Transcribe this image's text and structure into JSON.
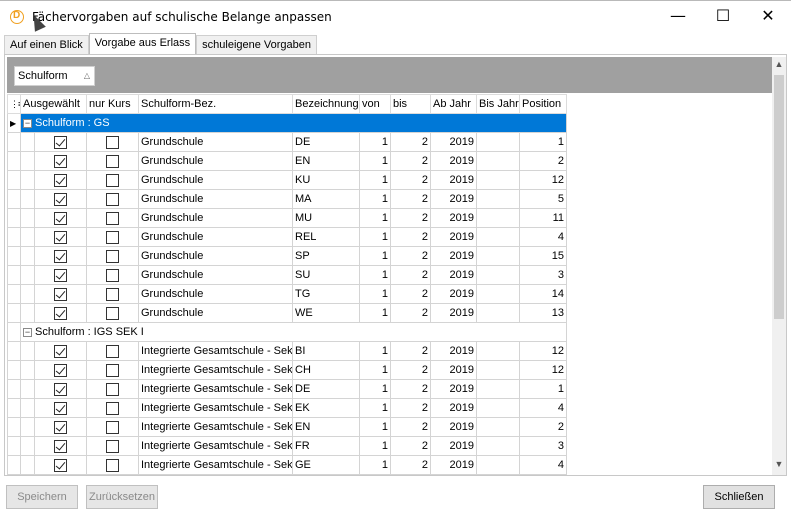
{
  "window": {
    "title": "Fächervorgaben auf schulische Belange anpassen",
    "minimize": "—",
    "maximize": "☐",
    "close": "✕"
  },
  "tabs": [
    {
      "label": "Auf einen Blick",
      "active": false
    },
    {
      "label": "Vorgabe aus Erlass",
      "active": true
    },
    {
      "label": "schuleigene Vorgaben",
      "active": false
    }
  ],
  "grouping": {
    "chip_label": "Schulform",
    "chip_sort_icon": "sort-asc-icon"
  },
  "grid": {
    "columns": [
      "Ausgewählt",
      "nur Kurs",
      "Schulform-Bez.",
      "Bezeichnung",
      "von",
      "bis",
      "Ab Jahr",
      "Bis Jahr",
      "Position"
    ],
    "groups": [
      {
        "label": "Schulform : GS",
        "selected": true,
        "rows": [
          {
            "ausgewaehlt": true,
            "nur_kurs": false,
            "schulform": "Grundschule",
            "bez": "DE",
            "von": "1",
            "bis": "2",
            "ab": "2019",
            "bis_jahr": "",
            "pos": "1"
          },
          {
            "ausgewaehlt": true,
            "nur_kurs": false,
            "schulform": "Grundschule",
            "bez": "EN",
            "von": "1",
            "bis": "2",
            "ab": "2019",
            "bis_jahr": "",
            "pos": "2"
          },
          {
            "ausgewaehlt": true,
            "nur_kurs": false,
            "schulform": "Grundschule",
            "bez": "KU",
            "von": "1",
            "bis": "2",
            "ab": "2019",
            "bis_jahr": "",
            "pos": "12"
          },
          {
            "ausgewaehlt": true,
            "nur_kurs": false,
            "schulform": "Grundschule",
            "bez": "MA",
            "von": "1",
            "bis": "2",
            "ab": "2019",
            "bis_jahr": "",
            "pos": "5"
          },
          {
            "ausgewaehlt": true,
            "nur_kurs": false,
            "schulform": "Grundschule",
            "bez": "MU",
            "von": "1",
            "bis": "2",
            "ab": "2019",
            "bis_jahr": "",
            "pos": "11"
          },
          {
            "ausgewaehlt": true,
            "nur_kurs": false,
            "schulform": "Grundschule",
            "bez": "REL",
            "von": "1",
            "bis": "2",
            "ab": "2019",
            "bis_jahr": "",
            "pos": "4"
          },
          {
            "ausgewaehlt": true,
            "nur_kurs": false,
            "schulform": "Grundschule",
            "bez": "SP",
            "von": "1",
            "bis": "2",
            "ab": "2019",
            "bis_jahr": "",
            "pos": "15"
          },
          {
            "ausgewaehlt": true,
            "nur_kurs": false,
            "schulform": "Grundschule",
            "bez": "SU",
            "von": "1",
            "bis": "2",
            "ab": "2019",
            "bis_jahr": "",
            "pos": "3"
          },
          {
            "ausgewaehlt": true,
            "nur_kurs": false,
            "schulform": "Grundschule",
            "bez": "TG",
            "von": "1",
            "bis": "2",
            "ab": "2019",
            "bis_jahr": "",
            "pos": "14"
          },
          {
            "ausgewaehlt": true,
            "nur_kurs": false,
            "schulform": "Grundschule",
            "bez": "WE",
            "von": "1",
            "bis": "2",
            "ab": "2019",
            "bis_jahr": "",
            "pos": "13"
          }
        ]
      },
      {
        "label": "Schulform : IGS SEK I",
        "selected": false,
        "rows": [
          {
            "ausgewaehlt": true,
            "nur_kurs": false,
            "schulform": "Integrierte Gesamtschule - Sek",
            "bez": "BI",
            "von": "1",
            "bis": "2",
            "ab": "2019",
            "bis_jahr": "",
            "pos": "12"
          },
          {
            "ausgewaehlt": true,
            "nur_kurs": false,
            "schulform": "Integrierte Gesamtschule - Sek",
            "bez": "CH",
            "von": "1",
            "bis": "2",
            "ab": "2019",
            "bis_jahr": "",
            "pos": "12"
          },
          {
            "ausgewaehlt": true,
            "nur_kurs": false,
            "schulform": "Integrierte Gesamtschule - Sek",
            "bez": "DE",
            "von": "1",
            "bis": "2",
            "ab": "2019",
            "bis_jahr": "",
            "pos": "1"
          },
          {
            "ausgewaehlt": true,
            "nur_kurs": false,
            "schulform": "Integrierte Gesamtschule - Sek",
            "bez": "EK",
            "von": "1",
            "bis": "2",
            "ab": "2019",
            "bis_jahr": "",
            "pos": "4"
          },
          {
            "ausgewaehlt": true,
            "nur_kurs": false,
            "schulform": "Integrierte Gesamtschule - Sek",
            "bez": "EN",
            "von": "1",
            "bis": "2",
            "ab": "2019",
            "bis_jahr": "",
            "pos": "2"
          },
          {
            "ausgewaehlt": true,
            "nur_kurs": false,
            "schulform": "Integrierte Gesamtschule - Sek",
            "bez": "FR",
            "von": "1",
            "bis": "2",
            "ab": "2019",
            "bis_jahr": "",
            "pos": "3"
          },
          {
            "ausgewaehlt": true,
            "nur_kurs": false,
            "schulform": "Integrierte Gesamtschule - Sek",
            "bez": "GE",
            "von": "1",
            "bis": "2",
            "ab": "2019",
            "bis_jahr": "",
            "pos": "4"
          },
          {
            "ausgewaehlt": true,
            "nur_kurs": false,
            "schulform": "",
            "bez": "",
            "von": "",
            "bis": "",
            "ab": "",
            "bis_jahr": "",
            "pos": ""
          }
        ]
      }
    ]
  },
  "footer": {
    "save": "Speichern",
    "reset": "Zurücksetzen",
    "close": "Schließen"
  },
  "colors": {
    "selection": "#0078d7",
    "group_bar": "#a0a0a0",
    "app_icon": "#f0a020"
  }
}
